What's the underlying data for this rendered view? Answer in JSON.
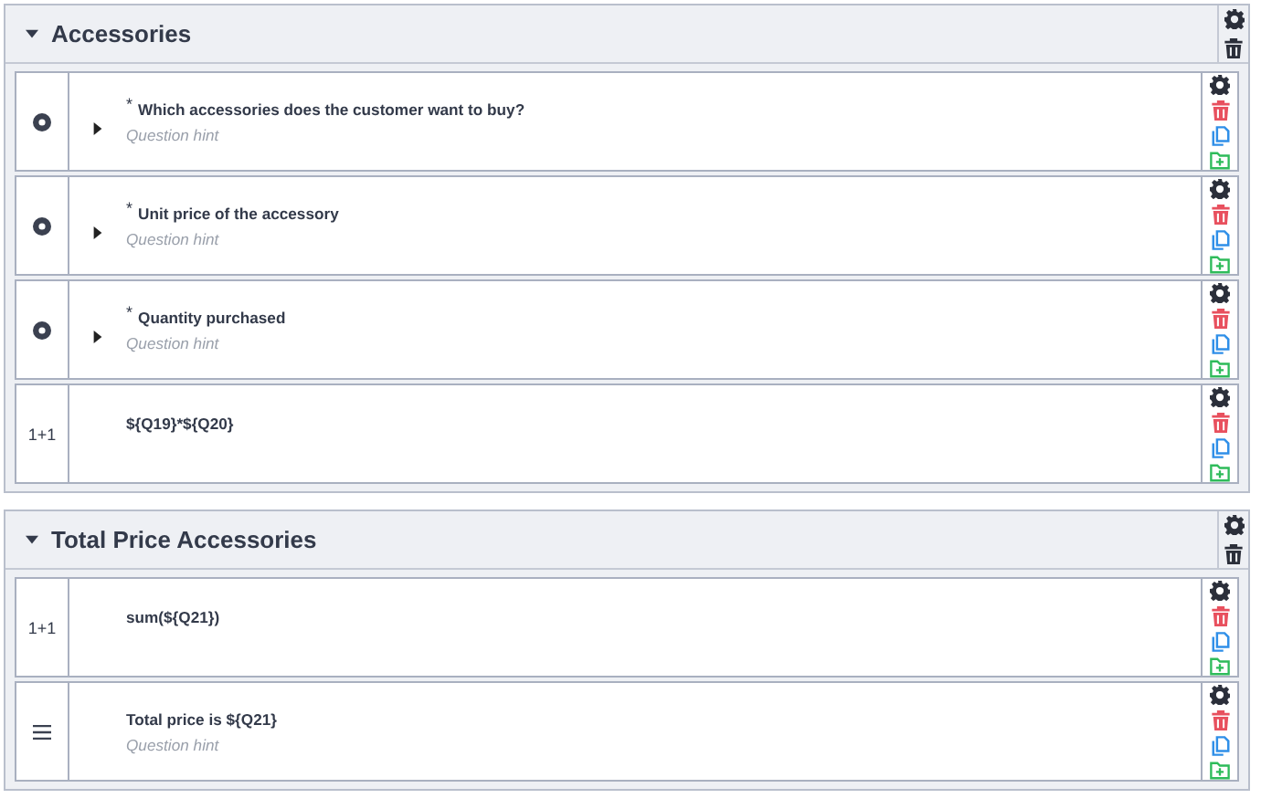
{
  "groups": [
    {
      "title": "Accessories",
      "expanded": true,
      "questions": [
        {
          "kind": "radio",
          "required_mark": "*",
          "expandable": true,
          "title": "Which accessories does the customer want to buy?",
          "hint": "Question hint"
        },
        {
          "kind": "radio",
          "required_mark": "*",
          "expandable": true,
          "title": "Unit price of the accessory",
          "hint": "Question hint"
        },
        {
          "kind": "radio",
          "required_mark": "*",
          "expandable": true,
          "title": "Quantity purchased",
          "hint": "Question hint"
        },
        {
          "kind": "equation",
          "type_label": "1+1",
          "expandable": false,
          "title": "${Q19}*${Q20}"
        }
      ]
    },
    {
      "title": "Total Price Accessories",
      "expanded": true,
      "questions": [
        {
          "kind": "equation",
          "type_label": "1+1",
          "expandable": false,
          "title": "sum(${Q21})"
        },
        {
          "kind": "text",
          "expandable": false,
          "title": "Total price is ${Q21}",
          "hint": "Question hint"
        }
      ]
    }
  ]
}
